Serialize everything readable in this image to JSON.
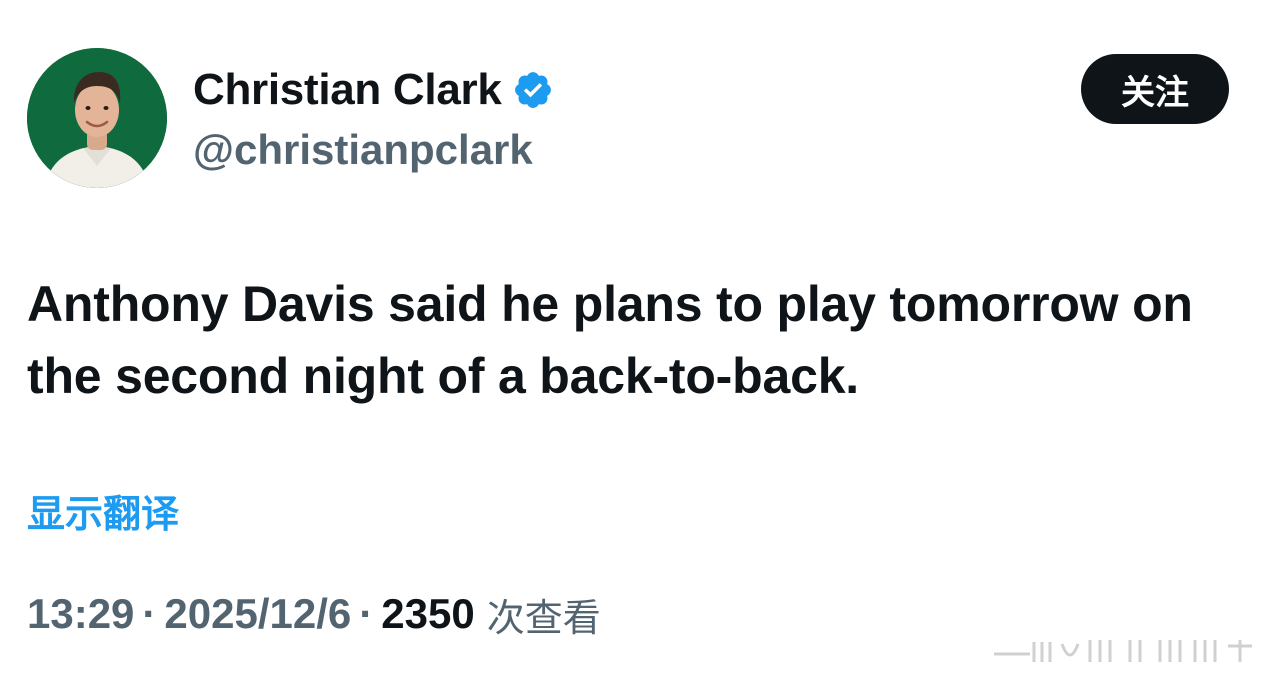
{
  "author": {
    "display_name": "Christian Clark",
    "handle": "@christianpclark",
    "verified": true,
    "avatar_bg": "#0f6b3d",
    "verified_color": "#1d9bf0"
  },
  "follow_button": {
    "label": "关注"
  },
  "tweet": {
    "text": "Anthony Davis said he plans to play tomorrow on the second night of a back-to-back.",
    "translate_label": "显示翻译"
  },
  "meta": {
    "time": "13:29",
    "separator": "·",
    "date": "2025/12/6",
    "views_count": "2350",
    "views_label": "次查看"
  },
  "icons": {
    "verified": "verified-badge-icon",
    "watermark": "watermark-icon"
  }
}
